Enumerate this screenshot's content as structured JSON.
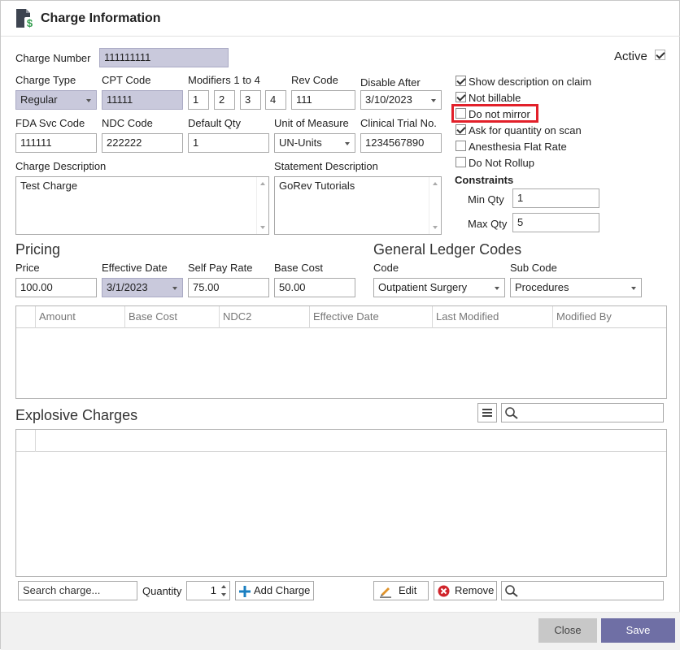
{
  "window": {
    "title": "Charge Information"
  },
  "active": {
    "label": "Active",
    "checked": true
  },
  "charge_number": {
    "label": "Charge Number",
    "value": "111111111"
  },
  "charge_type": {
    "label": "Charge Type",
    "value": "Regular"
  },
  "cpt_code": {
    "label": "CPT Code",
    "value": "11111"
  },
  "modifiers": {
    "label": "Modifiers 1 to 4",
    "values": [
      "1",
      "2",
      "3",
      "4"
    ]
  },
  "rev_code": {
    "label": "Rev Code",
    "value": "111"
  },
  "disable_after": {
    "label": "Disable After",
    "value": "3/10/2023"
  },
  "fda_svc_code": {
    "label": "FDA Svc Code",
    "value": "111111"
  },
  "ndc_code": {
    "label": "NDC Code",
    "value": "222222"
  },
  "default_qty": {
    "label": "Default Qty",
    "value": "1"
  },
  "unit_of_measure": {
    "label": "Unit of Measure",
    "value": "UN-Units"
  },
  "clinical_trial_no": {
    "label": "Clinical Trial No.",
    "value": "1234567890"
  },
  "charge_description": {
    "label": "Charge Description",
    "value": "Test Charge"
  },
  "statement_description": {
    "label": "Statement Description",
    "value": "GoRev Tutorials"
  },
  "options": [
    {
      "label": "Show description on claim",
      "checked": true
    },
    {
      "label": "Not billable",
      "checked": true
    },
    {
      "label": "Do not mirror",
      "checked": false
    },
    {
      "label": "Ask for quantity on scan",
      "checked": true
    },
    {
      "label": "Anesthesia Flat Rate",
      "checked": false
    },
    {
      "label": "Do Not Rollup",
      "checked": false
    }
  ],
  "constraints": {
    "label": "Constraints",
    "min_qty": {
      "label": "Min Qty",
      "value": "1"
    },
    "max_qty": {
      "label": "Max Qty",
      "value": "5"
    }
  },
  "pricing": {
    "heading": "Pricing",
    "price": {
      "label": "Price",
      "value": "100.00"
    },
    "effective_date": {
      "label": "Effective Date",
      "value": "3/1/2023"
    },
    "self_pay_rate": {
      "label": "Self Pay Rate",
      "value": "75.00"
    },
    "base_cost": {
      "label": "Base Cost",
      "value": "50.00"
    }
  },
  "gl_codes": {
    "heading": "General Ledger Codes",
    "code": {
      "label": "Code",
      "value": "Outpatient Surgery"
    },
    "sub_code": {
      "label": "Sub Code",
      "value": "Procedures"
    }
  },
  "price_grid": {
    "columns": [
      "Amount",
      "Base Cost",
      "NDC2",
      "Effective Date",
      "Last Modified",
      "Modified By"
    ]
  },
  "explosive": {
    "heading": "Explosive Charges",
    "search_placeholder": "Search charge...",
    "quantity_label": "Quantity",
    "quantity_value": "1",
    "add_label": "Add Charge",
    "edit_label": "Edit",
    "remove_label": "Remove"
  },
  "footer": {
    "close_label": "Close",
    "save_label": "Save"
  },
  "colors": {
    "readonly_bg": "#c9c9dc",
    "save_bg": "#6f6fa5",
    "close_bg": "#c8c8c8",
    "highlight": "#e2202a",
    "add_icon": "#1a7fc1",
    "remove_icon": "#d0242b"
  }
}
